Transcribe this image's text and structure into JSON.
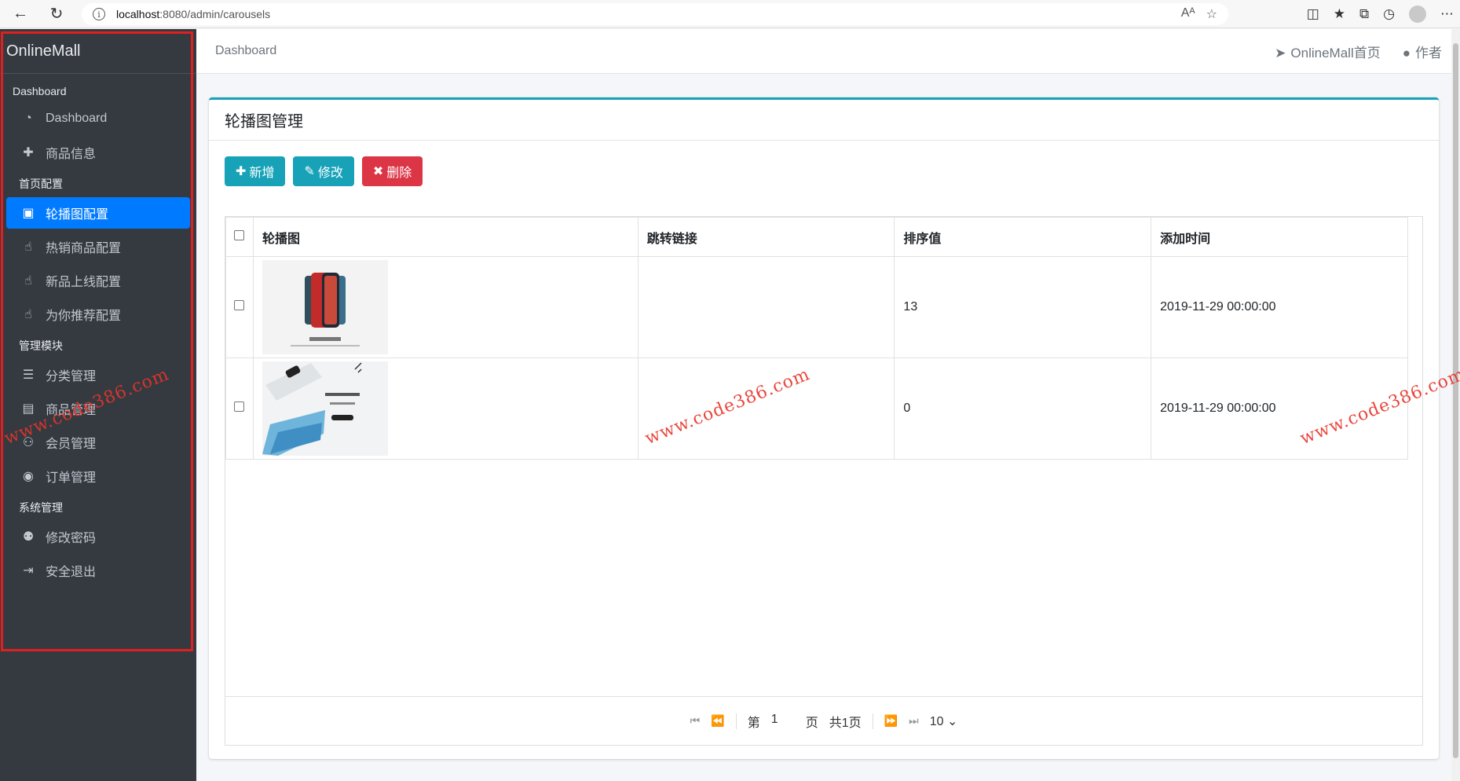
{
  "browser": {
    "url_host": "localhost",
    "url_rest": ":8080/admin/carousels",
    "reader_icon": "Aᴬ"
  },
  "sidebar": {
    "brand": "OnlineMall",
    "sections": [
      {
        "header": "Dashboard",
        "items": [
          {
            "label": "Dashboard",
            "icon": "tachometer-icon",
            "glyph": "◔",
            "active": false
          },
          {
            "label": "商品信息",
            "icon": "plus-icon",
            "glyph": "✚",
            "active": false
          }
        ]
      },
      {
        "header": "首页配置",
        "items": [
          {
            "label": "轮播图配置",
            "icon": "image-icon",
            "glyph": "▣",
            "active": true
          },
          {
            "label": "热销商品配置",
            "icon": "hand-pointer-icon",
            "glyph": "☝",
            "active": false
          },
          {
            "label": "新品上线配置",
            "icon": "hand-pointer-icon",
            "glyph": "☝",
            "active": false
          },
          {
            "label": "为你推荐配置",
            "icon": "hand-pointer-icon",
            "glyph": "☝",
            "active": false
          }
        ]
      },
      {
        "header": "管理模块",
        "items": [
          {
            "label": "分类管理",
            "icon": "list-icon",
            "glyph": "☰",
            "active": false
          },
          {
            "label": "商品管理",
            "icon": "archive-icon",
            "glyph": "▤",
            "active": false
          },
          {
            "label": "会员管理",
            "icon": "users-icon",
            "glyph": "⚇",
            "active": false
          },
          {
            "label": "订单管理",
            "icon": "money-bill-icon",
            "glyph": "◉",
            "active": false
          }
        ]
      },
      {
        "header": "系统管理",
        "items": [
          {
            "label": "修改密码",
            "icon": "user-secret-icon",
            "glyph": "⚉",
            "active": false
          },
          {
            "label": "安全退出",
            "icon": "sign-out-icon",
            "glyph": "⇥",
            "active": false
          }
        ]
      }
    ]
  },
  "topbar": {
    "breadcrumb": "Dashboard",
    "home_link": "OnlineMall首页",
    "author_link": "作者"
  },
  "card": {
    "title": "轮播图管理",
    "buttons": {
      "add": "新增",
      "edit": "修改",
      "delete": "删除"
    }
  },
  "table": {
    "columns": [
      "轮播图",
      "跳转链接",
      "排序值",
      "添加时间"
    ],
    "rows": [
      {
        "image": "iPhone 12 carousel",
        "link": "",
        "rank": "13",
        "created": "2019-11-29 00:00:00"
      },
      {
        "image": "HUAWEI P40 carousel",
        "link": "",
        "rank": "0",
        "created": "2019-11-29 00:00:00"
      }
    ]
  },
  "pager": {
    "page_prefix": "第",
    "page_value": "1",
    "page_suffix": "页",
    "total": "共1页",
    "page_size": "10"
  },
  "watermark": "www.code386.com",
  "colors": {
    "sidebar_bg": "#343a40",
    "active": "#007bff",
    "info": "#17a2b8",
    "danger": "#dc3545",
    "highlight_border": "#e02020"
  }
}
